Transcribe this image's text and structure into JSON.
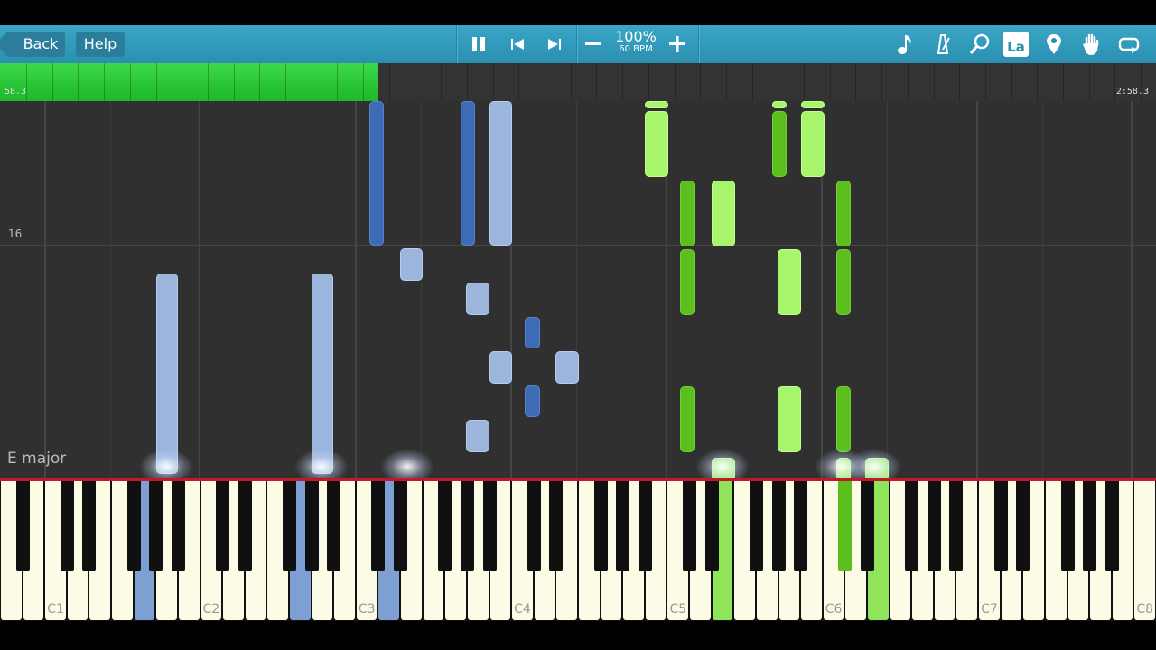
{
  "toolbar": {
    "back_label": "Back",
    "help_label": "Help",
    "speed_percent": "100%",
    "speed_bpm": "60 BPM",
    "icons": [
      "pause-icon",
      "skip-back-icon",
      "skip-forward-icon",
      "minus-icon",
      "plus-icon",
      "note-icon",
      "metronome-icon",
      "zoom-icon",
      "la-icon",
      "pin-icon",
      "hand-icon",
      "loop-icon"
    ],
    "la_label": "La"
  },
  "progress": {
    "elapsed": "58.3",
    "total": "2:58.3",
    "fraction": 0.327,
    "color": "#2ecf3c"
  },
  "roll": {
    "measure_number": "16",
    "key_signature": "E major"
  },
  "keyboard": {
    "octave_labels": [
      "C1",
      "C2",
      "C3",
      "C4",
      "C5",
      "C6",
      "C7",
      "C8"
    ]
  },
  "colors": {
    "left_hand_light": "#9cb5dd",
    "left_hand_dark": "#3e6bb5",
    "right_hand_light": "#a7f56a",
    "right_hand_dark": "#5cbf1e"
  }
}
